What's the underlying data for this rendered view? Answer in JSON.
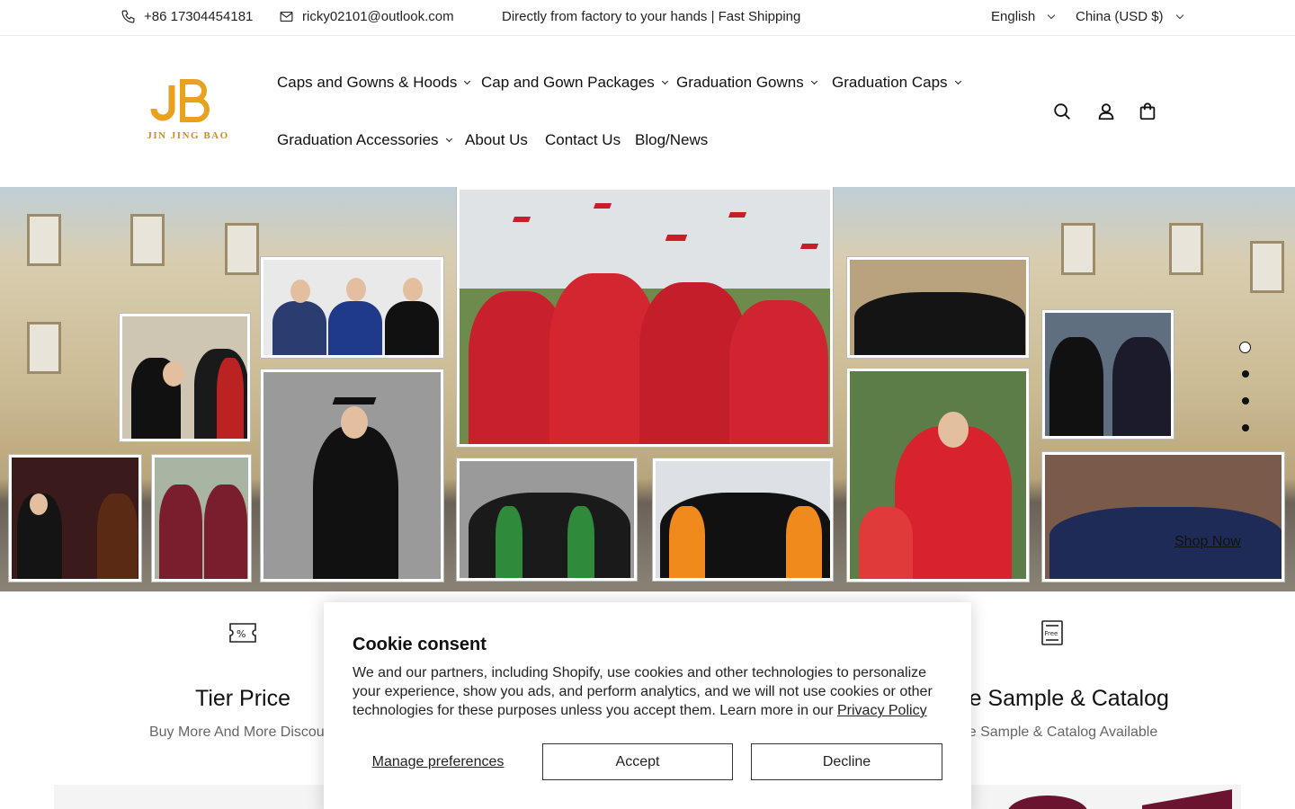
{
  "topbar": {
    "phone": "+86 17304454181",
    "email": "ricky02101@outlook.com",
    "tagline": "Directly from factory to your hands | Fast Shipping",
    "language": "English",
    "currency": "China (USD $)"
  },
  "header": {
    "logo_text": "JIN JING BAO",
    "nav": [
      {
        "label": "Caps and Gowns & Hoods",
        "has_dropdown": true
      },
      {
        "label": "Cap and Gown Packages",
        "has_dropdown": true
      },
      {
        "label": "Graduation Gowns",
        "has_dropdown": true
      },
      {
        "label": "Graduation Caps",
        "has_dropdown": true
      },
      {
        "label": "Graduation Accessories",
        "has_dropdown": true
      },
      {
        "label": "About Us",
        "has_dropdown": false
      },
      {
        "label": "Contact Us",
        "has_dropdown": false
      },
      {
        "label": "Blog/News",
        "has_dropdown": false
      }
    ],
    "icons": [
      "search-icon",
      "account-icon",
      "cart-icon"
    ]
  },
  "hero": {
    "cta": "Shop Now",
    "slides": 4,
    "active_slide": 1
  },
  "features": [
    {
      "icon": "percent-ticket-icon",
      "title": "Tier Price",
      "desc": "Buy More And More Discount"
    },
    {
      "icon": "free-catalog-icon",
      "title": "Free Sample & Catalog",
      "desc": "Free Sample & Catalog Available"
    }
  ],
  "cookie": {
    "title": "Cookie consent",
    "body": "We and our partners, including Shopify, use cookies and other technologies to personalize your experience, show you ads, and perform analytics, and we will not use cookies or other technologies for these purposes unless you accept them. Learn more in our ",
    "link": "Privacy Policy",
    "manage": "Manage preferences",
    "accept": "Accept",
    "decline": "Decline"
  },
  "colors": {
    "brand_gold": "#e9a21f",
    "text": "#111111"
  }
}
